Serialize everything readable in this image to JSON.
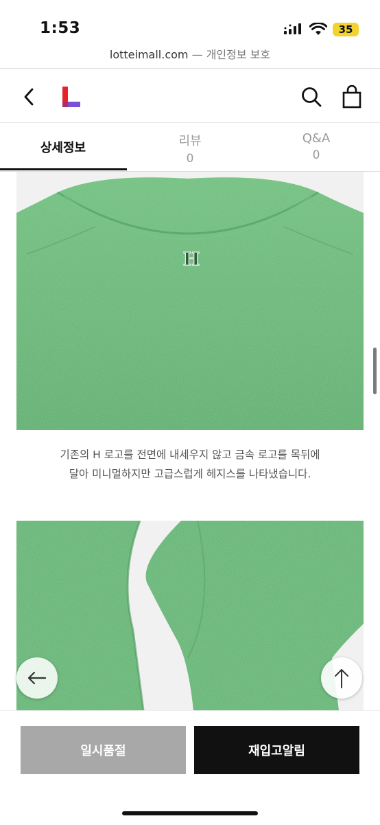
{
  "status_bar": {
    "time": "1:53",
    "battery": "35"
  },
  "browser": {
    "domain": "lotteimall.com",
    "separator": "—",
    "subtitle": "개인정보 보호"
  },
  "header": {
    "logo": "L"
  },
  "tabs": [
    {
      "label": "상세정보",
      "count": "",
      "active": true
    },
    {
      "label": "리뷰",
      "count": "0",
      "active": false
    },
    {
      "label": "Q&A",
      "count": "0",
      "active": false
    }
  ],
  "content": {
    "description_line1": "기존의 H 로고를 전면에 내세우지 않고 금속 로고를 목뒤에",
    "description_line2": "달아 미니멀하지만 고급스럽게 헤지스를 나타냈습니다.",
    "logo_letter": "H"
  },
  "actions": {
    "soldout_label": "일시품절",
    "restock_label": "재입고알림"
  },
  "colors": {
    "sweater_green": "#5fb06f",
    "accent_red": "#e4232b",
    "accent_purple": "#7b4fd8"
  },
  "icons": [
    "chevron-left-icon",
    "search-icon",
    "shopping-bag-icon",
    "arrow-left-icon",
    "arrow-up-icon"
  ]
}
